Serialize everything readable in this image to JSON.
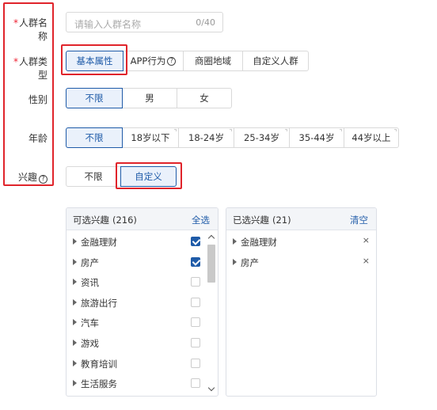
{
  "form": {
    "name_label": "人群名称",
    "name_placeholder": "请输入人群名称",
    "name_counter": "0/40",
    "type_label": "人群类型",
    "gender_label": "性别",
    "age_label": "年龄",
    "interest_label": "兴趣"
  },
  "type_tabs": [
    "基本属性",
    "APP行为",
    "商圈地域",
    "自定义人群"
  ],
  "gender_options": [
    "不限",
    "男",
    "女"
  ],
  "age_options": [
    "不限",
    "18岁以下",
    "18-24岁",
    "25-34岁",
    "35-44岁",
    "44岁以上"
  ],
  "interest_options": [
    "不限",
    "自定义"
  ],
  "available": {
    "title": "可选兴趣",
    "count": "(216)",
    "action": "全选",
    "items": [
      {
        "label": "金融理财",
        "checked": true
      },
      {
        "label": "房产",
        "checked": true
      },
      {
        "label": "资讯",
        "checked": false
      },
      {
        "label": "旅游出行",
        "checked": false
      },
      {
        "label": "汽车",
        "checked": false
      },
      {
        "label": "游戏",
        "checked": false
      },
      {
        "label": "教育培训",
        "checked": false
      },
      {
        "label": "生活服务",
        "checked": false
      }
    ]
  },
  "selected": {
    "title": "已选兴趣",
    "count": "(21)",
    "action": "清空",
    "items": [
      "金融理财",
      "房产"
    ],
    "remove_glyph": "×"
  },
  "colors": {
    "accent": "#1f5ba8",
    "highlight": "#e0242b"
  }
}
